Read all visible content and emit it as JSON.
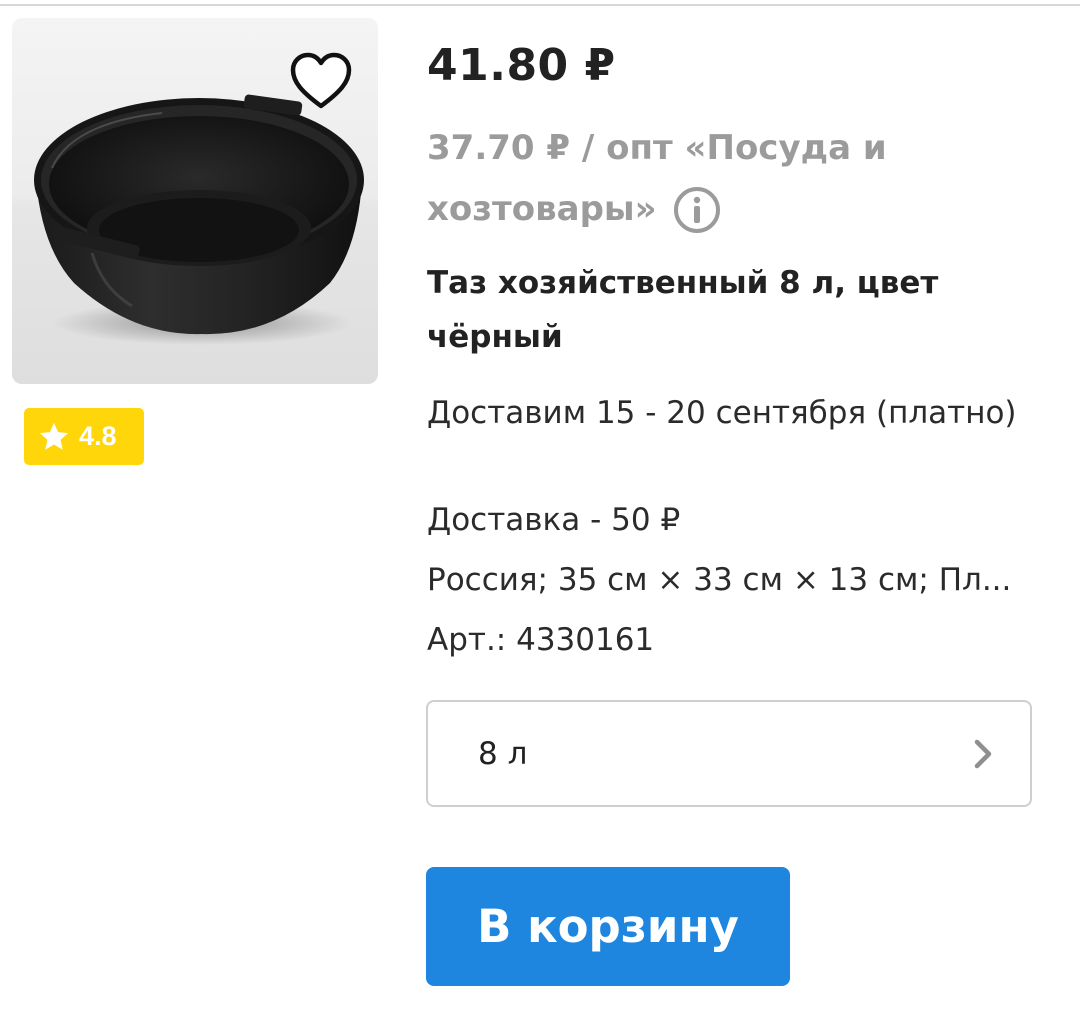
{
  "product": {
    "price": "41.80 ₽",
    "wholesale_line1": "37.70 ₽ / опт «Посуда и",
    "wholesale_line2": "хозтовары»",
    "title": "Таз хозяйственный 8 л, цвет чёрный",
    "delivery_date": "Доставим 15 - 20 сентября (платно)",
    "delivery_cost": "Доставка - 50 ₽",
    "specs": "Россия; 35 см × 33 см × 13 см; Пл...",
    "sku": "Арт.: 4330161",
    "rating": "4.8",
    "variant": "8 л",
    "add_to_cart_label": "В корзину"
  },
  "icons": {
    "favorite": "heart-outline-icon",
    "info": "info-circle-icon",
    "rating": "star-icon",
    "variant_arrow": "chevron-right-icon"
  },
  "colors": {
    "accent": "#1e86df",
    "rating_badge": "#ffd60a",
    "muted_text": "#9b9b9b",
    "border": "#cfcfcf"
  }
}
